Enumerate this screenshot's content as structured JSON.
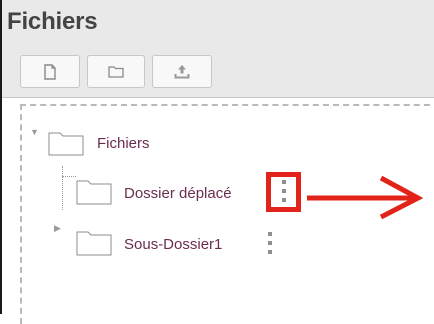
{
  "panel": {
    "title": "Fichiers",
    "toolbar": [
      {
        "name": "new-file-button",
        "icon": "file-icon"
      },
      {
        "name": "new-folder-button",
        "icon": "folder-icon"
      },
      {
        "name": "upload-button",
        "icon": "upload-icon"
      }
    ]
  },
  "tree": {
    "nodes": [
      {
        "label": "Fichiers",
        "expanded": true,
        "level": 0
      },
      {
        "label": "Dossier déplacé",
        "level": 1,
        "menu_highlighted": true
      },
      {
        "label": "Sous-Dossier1",
        "expanded": false,
        "level": 1
      }
    ]
  },
  "annotation": {
    "color": "#e2231a"
  }
}
